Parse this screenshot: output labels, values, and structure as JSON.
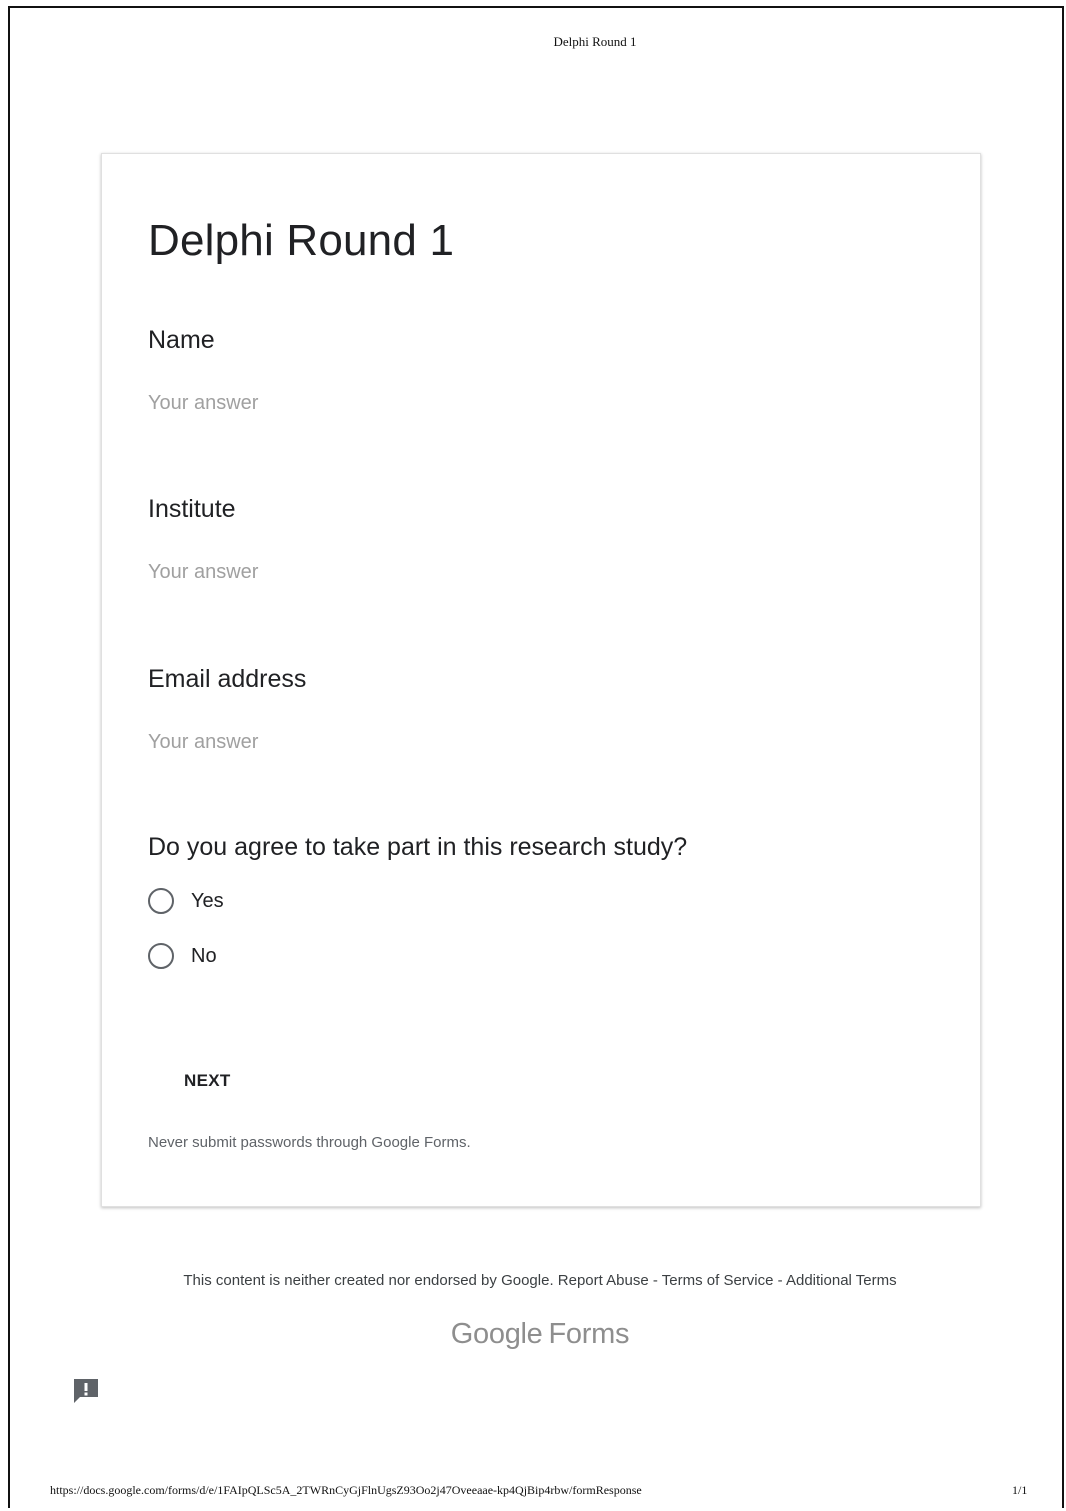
{
  "print_header": {
    "title": "Delphi Round 1"
  },
  "form": {
    "title": "Delphi Round 1",
    "questions": [
      {
        "label": "Name",
        "placeholder": "Your answer"
      },
      {
        "label": "Institute",
        "placeholder": "Your answer"
      },
      {
        "label": "Email address",
        "placeholder": "Your answer"
      }
    ],
    "consent": {
      "label": "Do you agree to take part in this research study?",
      "options": [
        "Yes",
        "No"
      ]
    },
    "next_label": "NEXT",
    "password_warning": "Never submit passwords through Google Forms."
  },
  "footer": {
    "disclaimer": "This content is neither created nor endorsed by Google.",
    "report_abuse": "Report Abuse",
    "separator": "-",
    "terms_of_service": "Terms of Service",
    "additional_terms": "Additional Terms",
    "brand_google": "Google",
    "brand_forms": "Forms"
  },
  "feedback": {
    "icon": "report-feedback-icon"
  },
  "print_footer": {
    "url": "https://docs.google.com/forms/d/e/1FAIpQLSc5A_2TWRnCyGjFlnUgsZ93Oo2j47Oveeaae-kp4QjBip4rbw/formResponse",
    "page": "1/1"
  },
  "colors": {
    "text": "#202124",
    "placeholder": "#a0a0a0",
    "muted": "#5f6368",
    "brand_gray": "#8e8e8e"
  }
}
